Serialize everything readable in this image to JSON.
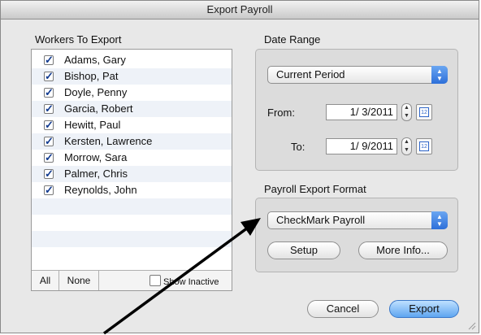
{
  "window": {
    "title": "Export Payroll"
  },
  "workers": {
    "heading": "Workers To Export",
    "items": [
      {
        "name": "Adams, Gary",
        "checked": true
      },
      {
        "name": "Bishop, Pat",
        "checked": true
      },
      {
        "name": "Doyle, Penny",
        "checked": true
      },
      {
        "name": "Garcia, Robert",
        "checked": true
      },
      {
        "name": "Hewitt, Paul",
        "checked": true
      },
      {
        "name": "Kersten, Lawrence",
        "checked": true
      },
      {
        "name": "Morrow, Sara",
        "checked": true
      },
      {
        "name": "Palmer, Chris",
        "checked": true
      },
      {
        "name": "Reynolds, John",
        "checked": true
      }
    ],
    "all_label": "All",
    "none_label": "None",
    "show_inactive_label": "Show Inactive"
  },
  "date_range": {
    "heading": "Date Range",
    "period_selected": "Current Period",
    "from_label": "From:",
    "from_value": "1/ 3/2011",
    "to_label": "To:",
    "to_value": "1/ 9/2011",
    "calendar_day": "12"
  },
  "export_format": {
    "heading": "Payroll Export Format",
    "selected": "CheckMark Payroll",
    "setup_label": "Setup",
    "more_info_label": "More Info..."
  },
  "actions": {
    "cancel_label": "Cancel",
    "export_label": "Export"
  }
}
